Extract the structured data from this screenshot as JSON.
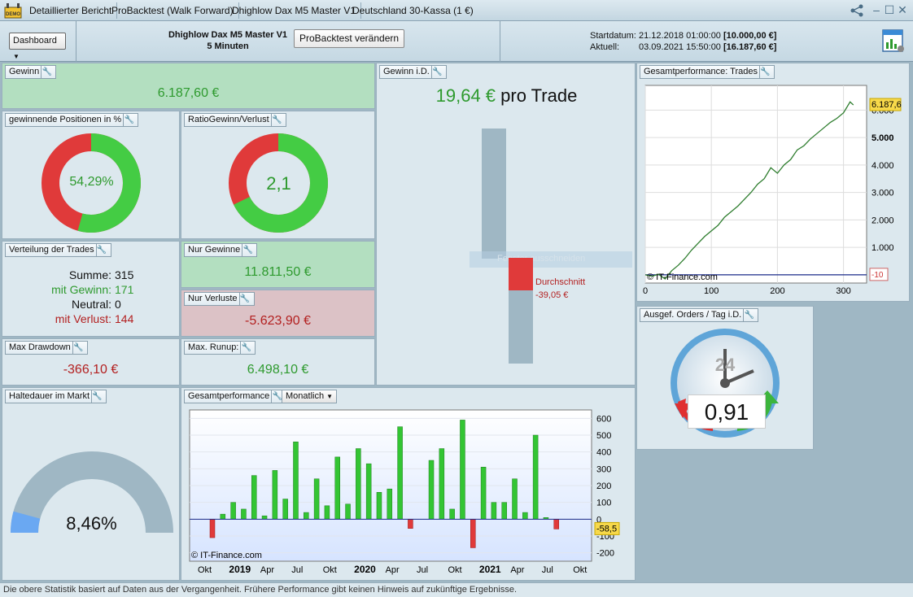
{
  "tabs": [
    {
      "label": "Detaillierter Bericht"
    },
    {
      "label": "ProBacktest (Walk Forward)"
    },
    {
      "label": "Dhighlow Dax M5 Master V1"
    },
    {
      "label": "Deutschland 30-Kassa (1 €)"
    }
  ],
  "logo_text": "DEMO",
  "header": {
    "dashboard_label": "Dashboard",
    "strategy_name": "Dhighlow Dax M5 Master V1",
    "timeframe": "5 Minuten",
    "modify_button": "ProBacktest verändern",
    "start_label": "Startdatum:",
    "start_date": "21.12.2018 01:00:00",
    "start_capital": "[10.000,00 €]",
    "current_label": "Aktuell:",
    "current_date": "03.09.2021 15:50:00",
    "current_capital": "[16.187,60 €]"
  },
  "gewinn": {
    "title": "Gewinn",
    "value": "6.187,60 €"
  },
  "winning_pct": {
    "title": "gewinnende Positionen in %",
    "value": "54,29%",
    "fraction": 0.5429
  },
  "ratio": {
    "title": "RatioGewinn/Verlust",
    "value": "2,1",
    "fraction": 0.677
  },
  "distribution": {
    "title": "Verteilung der Trades",
    "sum_label": "Summe:",
    "sum": "315",
    "win_label": "mit Gewinn:",
    "win": "171",
    "neutral_label": "Neutral:",
    "neutral": "0",
    "loss_label": "mit Verlust:",
    "loss": "144"
  },
  "only_gains": {
    "title": "Nur Gewinne",
    "value": "11.811,50 €"
  },
  "only_losses": {
    "title": "Nur Verluste",
    "value": "-5.623,90 €"
  },
  "max_drawdown": {
    "title": "Max Drawdown",
    "value": "-366,10 €"
  },
  "max_runup": {
    "title": "Max. Runup:",
    "value": "6.498,10 €"
  },
  "gain_avg": {
    "title": "Gewinn i.D.",
    "value": "19,64 €",
    "suffix": "pro Trade",
    "avg_label": "Durchschnitt",
    "avg_value": "-39,05 €",
    "ghost_menu": "Fenster ausschneiden"
  },
  "hold_time": {
    "title": "Haltedauer im Markt",
    "value": "8,46%",
    "fraction": 0.0846
  },
  "orders": {
    "title": "Ausgef. Orders / Tag i.D.",
    "value": "0,91",
    "dial_number": "24"
  },
  "equity_chart": {
    "title": "Gesamtperformance: Trades",
    "copyright": "© IT-Finance.com",
    "last_value_label": "6.187,6",
    "min_value_label": "-10"
  },
  "monthly_chart": {
    "title": "Gesamtperformance",
    "period": "Monatlich",
    "copyright": "© IT-Finance.com",
    "last_value_label": "-58,5"
  },
  "chart_data": [
    {
      "type": "line",
      "title": "Gesamtperformance: Trades",
      "x": [
        0,
        10,
        20,
        30,
        40,
        50,
        60,
        70,
        80,
        90,
        100,
        110,
        120,
        130,
        140,
        150,
        160,
        170,
        180,
        190,
        200,
        210,
        220,
        230,
        240,
        250,
        260,
        270,
        280,
        290,
        300,
        305,
        310,
        315
      ],
      "y": [
        0,
        -50,
        20,
        -150,
        150,
        350,
        600,
        900,
        1150,
        1400,
        1600,
        1800,
        2100,
        2300,
        2500,
        2750,
        3000,
        3300,
        3500,
        3900,
        3700,
        4000,
        4200,
        4550,
        4700,
        4950,
        5150,
        5350,
        5550,
        5700,
        5900,
        6100,
        6300,
        6187.6
      ],
      "xlim": [
        0,
        335
      ],
      "ylim": [
        -300,
        6900
      ],
      "xticks": [
        0,
        100,
        200,
        300
      ],
      "yticks": [
        1000,
        2000,
        3000,
        4000,
        5000,
        6000
      ],
      "ytick_labels": [
        "1.000",
        "2.000",
        "3.000",
        "4.000",
        "5.000",
        "6.000"
      ],
      "line_color": "#2e7d2e",
      "baseline_color": "#1a2a8a"
    },
    {
      "type": "bar",
      "title": "Gesamtperformance",
      "values": [
        -110,
        30,
        100,
        60,
        260,
        20,
        290,
        120,
        460,
        40,
        240,
        80,
        370,
        90,
        420,
        330,
        160,
        180,
        550,
        -55,
        0,
        350,
        420,
        60,
        590,
        -170,
        310,
        100,
        100,
        240,
        40,
        500,
        10,
        -58.5
      ],
      "ylim": [
        -250,
        650
      ],
      "yticks": [
        -200,
        -100,
        0,
        100,
        200,
        300,
        400,
        500,
        600
      ],
      "xtick_labels": [
        {
          "label": "Okt",
          "index": 0,
          "bold": false
        },
        {
          "label": "2019",
          "index": 3,
          "bold": true
        },
        {
          "label": "Apr",
          "index": 6,
          "bold": false
        },
        {
          "label": "Jul",
          "index": 9,
          "bold": false
        },
        {
          "label": "Okt",
          "index": 12,
          "bold": false
        },
        {
          "label": "2020",
          "index": 15,
          "bold": true
        },
        {
          "label": "Apr",
          "index": 18,
          "bold": false
        },
        {
          "label": "Jul",
          "index": 21,
          "bold": false
        },
        {
          "label": "Okt",
          "index": 24,
          "bold": false
        },
        {
          "label": "2021",
          "index": 27,
          "bold": true
        },
        {
          "label": "Apr",
          "index": 30,
          "bold": false
        },
        {
          "label": "Jul",
          "index": 33,
          "bold": false
        },
        {
          "label": "Okt",
          "index": 36,
          "bold": false
        }
      ],
      "positive_color": "#33c533",
      "negative_color": "#e03a3a"
    }
  ],
  "footer": "Die obere Statistik basiert auf Daten aus der Vergangenheit. Frühere Performance gibt keinen Hinweis auf zukünftige Ergebnisse."
}
